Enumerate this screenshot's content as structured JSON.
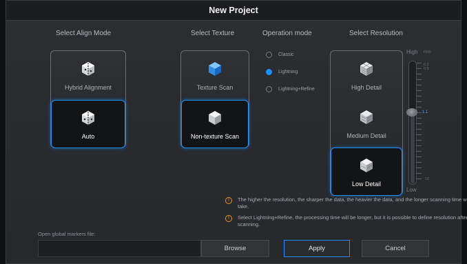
{
  "dialog": {
    "title": "New Project"
  },
  "align_mode": {
    "title": "Select Align Mode",
    "options": [
      {
        "label": "Hybrid Alignment",
        "icon": "hybrid-alignment-icon",
        "selected": false
      },
      {
        "label": "Auto",
        "icon": "auto-align-icon",
        "selected": true
      }
    ]
  },
  "texture": {
    "title": "Select Texture",
    "options": [
      {
        "label": "Texture Scan",
        "icon": "texture-cube-icon",
        "selected": false
      },
      {
        "label": "Non-texture Scan",
        "icon": "non-texture-cube-icon",
        "selected": true
      }
    ]
  },
  "operation_mode": {
    "title": "Operation mode",
    "options": [
      {
        "label": "Classic",
        "selected": false
      },
      {
        "label": "Lightning",
        "selected": true
      },
      {
        "label": "Lightning+Refine",
        "selected": false
      }
    ]
  },
  "resolution": {
    "title": "Select Resolution",
    "options": [
      {
        "label": "High Detail",
        "selected": false
      },
      {
        "label": "Medium Detail",
        "selected": false
      },
      {
        "label": "Low Detail",
        "selected": true
      }
    ],
    "slider": {
      "high_label": "High",
      "unit": "mm",
      "low_label": "Low",
      "top_values": [
        "0.2",
        "0.5"
      ],
      "value": "1.1",
      "bottom_value": "10"
    }
  },
  "notes": [
    "The higher the resolution, the sharper the data, the heavier the data, and the longer scanning time will take.",
    "Select Lightning+Refine, the processing time will be longer, but it is possible to define resolution after scanning."
  ],
  "markers": {
    "label": "Open global markers file:",
    "value": "",
    "placeholder": ""
  },
  "buttons": {
    "browse": "Browse",
    "apply": "Apply",
    "cancel": "Cancel"
  },
  "colors": {
    "accent": "#1f8fff",
    "warning": "#e39a1a",
    "background": "#26282b"
  }
}
